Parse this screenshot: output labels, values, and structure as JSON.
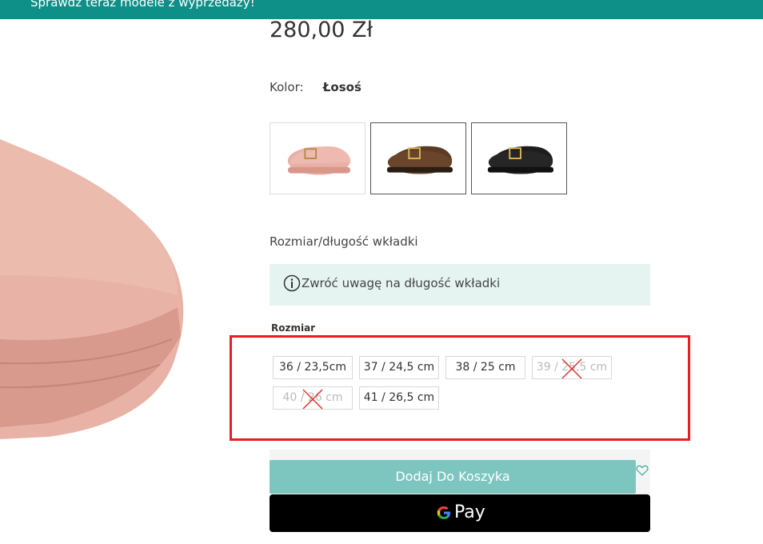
{
  "promo": {
    "text": "Sprawdź teraz modele z wyprzedaży!"
  },
  "product": {
    "price": "280,00 Zł",
    "color_label": "Kolor:",
    "color_value": "Łosoś",
    "swatches": [
      {
        "color": "#e8b0a8",
        "selected": false
      },
      {
        "color": "#5b3b25",
        "selected": true
      },
      {
        "color": "#1d1d1d",
        "selected": true
      }
    ],
    "size_section_title": "Rozmiar/długość wkładki",
    "info_text": "Zwróć uwagę na długość wkładki",
    "size_label": "Rozmiar",
    "sizes": [
      {
        "label": "36 / 23,5cm",
        "available": true
      },
      {
        "label": "37 / 24,5 cm",
        "available": true
      },
      {
        "label": "38 / 25 cm",
        "available": true
      },
      {
        "label": "39 / 25,5 cm",
        "available": false
      },
      {
        "label": "40 / 26 cm",
        "available": false
      },
      {
        "label": "41 / 26,5 cm",
        "available": true
      }
    ]
  },
  "actions": {
    "add_to_cart": "Dodaj Do Koszyka",
    "gpay_label": "Pay"
  },
  "colors": {
    "brand": "#0e8f87",
    "cart_button": "#7dc6c0",
    "info_bg": "#e6f4f1",
    "highlight": "#ec1c24"
  }
}
